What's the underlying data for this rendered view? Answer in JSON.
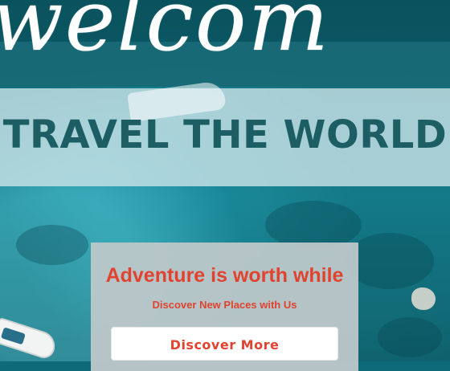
{
  "hero": {
    "script_text": "welcom",
    "title": "TRAVEL THE WORLD"
  },
  "cta": {
    "heading": "Adventure is worth while",
    "subheading": "Discover New Places with Us",
    "button_label": "Discover More"
  },
  "colors": {
    "accent": "#e0432f",
    "title_text": "#1c5e64",
    "water": "#0f6a78",
    "card_bg": "#bac7c9"
  }
}
